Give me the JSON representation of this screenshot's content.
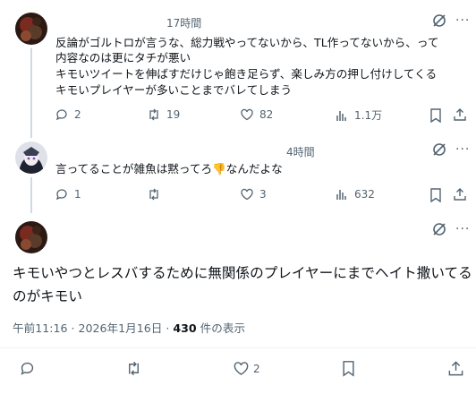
{
  "reply1": {
    "time": "17時間",
    "lines": [
      "反論がゴルトロが言うな、総力戦やってないから、TL作ってないから、って",
      "内容なのは更にタチが悪い",
      "キモいツイートを伸ばすだけじゃ飽き足らず、楽しみ方の押し付けしてくる",
      "キモいプレイヤーが多いことまでバレてしまう"
    ],
    "replies": "2",
    "reposts": "19",
    "likes": "82",
    "views": "1.1万"
  },
  "reply2": {
    "time": "4時間",
    "text_before": "言ってることが雑魚は黙ってろ",
    "emoji": "👎",
    "text_after": "なんだよな",
    "replies": "1",
    "reposts": "",
    "likes": "3",
    "views": "632"
  },
  "main_post": {
    "lines": [
      "キモいやつとレスバするために無関係のプレイヤーにまでヘイト撒いてる",
      "のがキモい"
    ],
    "timestamp": "午前11:16 · 2026年1月16日 · ",
    "view_count": "430",
    "view_suffix": " 件の表示",
    "likes": "2"
  },
  "colors": {
    "text": "#0f1419",
    "secondary": "#536471",
    "divider": "#eff3f4",
    "thread_line": "#cfd9de"
  }
}
